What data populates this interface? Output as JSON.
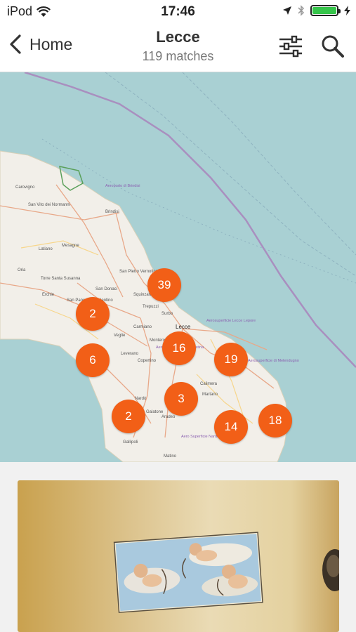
{
  "status_bar": {
    "carrier": "iPod",
    "time": "17:46",
    "battery_level": 1.0
  },
  "nav": {
    "back_label": "Home",
    "title": "Lecce",
    "subtitle": "119 matches"
  },
  "map": {
    "place_labels": [
      "Carovigno",
      "San Vito dei Normanni",
      "Brindisi",
      "Mesagne",
      "Latiano",
      "Oria",
      "Torre Santa Susanna",
      "Erchie",
      "San Pancrazio Salentino",
      "San Donaci",
      "Squinzano",
      "Trepuzzi",
      "Lecce",
      "Surbo",
      "Carmiano",
      "Veglie",
      "Leverano",
      "Monteroni di Lecce",
      "Copertino",
      "Nardò",
      "Galatone",
      "Aradeo",
      "Gallipoli",
      "Matino",
      "Calimera",
      "Martano",
      "San Pietro Vernotico",
      "Aeroporto di Brindisi",
      "Aerosuperficie Lecce Lepore",
      "Aeroporto di Lecce Galatina",
      "Aerosuperficie di Melendugno",
      "Aero Superficie Nardò"
    ],
    "clusters": [
      {
        "label": "39"
      },
      {
        "label": "2"
      },
      {
        "label": "16"
      },
      {
        "label": "6"
      },
      {
        "label": "19"
      },
      {
        "label": "3"
      },
      {
        "label": "2"
      },
      {
        "label": "14"
      },
      {
        "label": "18"
      }
    ],
    "colors": {
      "sea": "#a9d0d3",
      "land": "#f2efe9",
      "cluster": "#f25f17"
    }
  },
  "card": {
    "image_desc": "photo of painting with cherubs on a wall"
  }
}
